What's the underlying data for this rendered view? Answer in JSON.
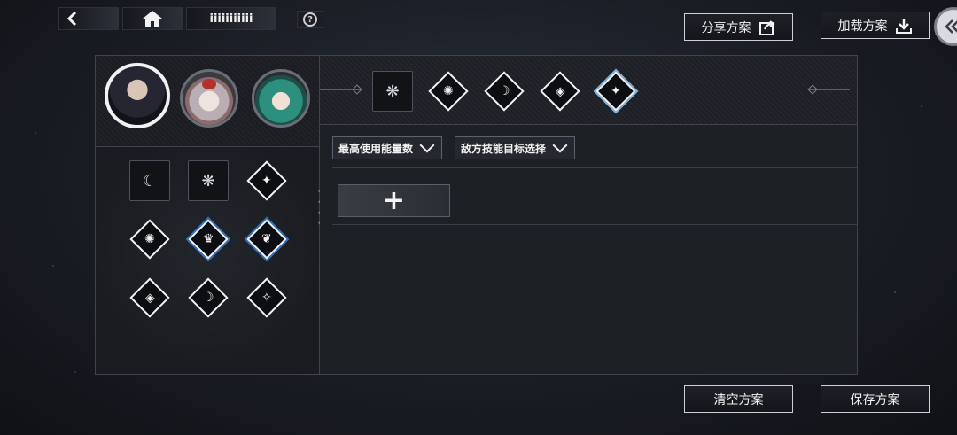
{
  "topbar": {
    "back_icon": "arrow-left-icon",
    "home_icon": "home-icon",
    "name_label": "iiiiiiiiiii",
    "help_label": "?"
  },
  "actions": {
    "share_label": "分享方案",
    "load_label": "加载方案",
    "clear_label": "清空方案",
    "save_label": "保存方案"
  },
  "characters": [
    {
      "name": "character-1",
      "selected": true
    },
    {
      "name": "character-2",
      "selected": false
    },
    {
      "name": "character-3",
      "selected": false
    }
  ],
  "skill_icons": [
    {
      "icon": "scythe-icon",
      "style": "square"
    },
    {
      "icon": "butterfly-icon",
      "style": "square"
    },
    {
      "icon": "crystal-icon",
      "style": "diamond"
    },
    {
      "icon": "beast-icon",
      "style": "diamond"
    },
    {
      "icon": "crown-icon",
      "style": "diamond-blue"
    },
    {
      "icon": "wing-icon",
      "style": "diamond-blue"
    },
    {
      "icon": "shield-icon",
      "style": "diamond"
    },
    {
      "icon": "moon-icon",
      "style": "diamond"
    },
    {
      "icon": "mask-icon",
      "style": "diamond"
    }
  ],
  "skill_bar": [
    {
      "icon": "butterfly-icon",
      "style": "square"
    },
    {
      "icon": "beast-icon",
      "style": "diamond"
    },
    {
      "icon": "moon-icon",
      "style": "diamond"
    },
    {
      "icon": "shield-icon",
      "style": "diamond"
    },
    {
      "icon": "crystal-icon",
      "style": "diamond-lightblue"
    }
  ],
  "filters": {
    "energy_label": "最高使用能量数",
    "target_label": "敌方技能目标选择"
  },
  "add_label": "+",
  "colors": {
    "accent_blue": "#2e6fc0",
    "accent_lightblue": "#7fb0d9",
    "panel_border": "#3e434d"
  }
}
